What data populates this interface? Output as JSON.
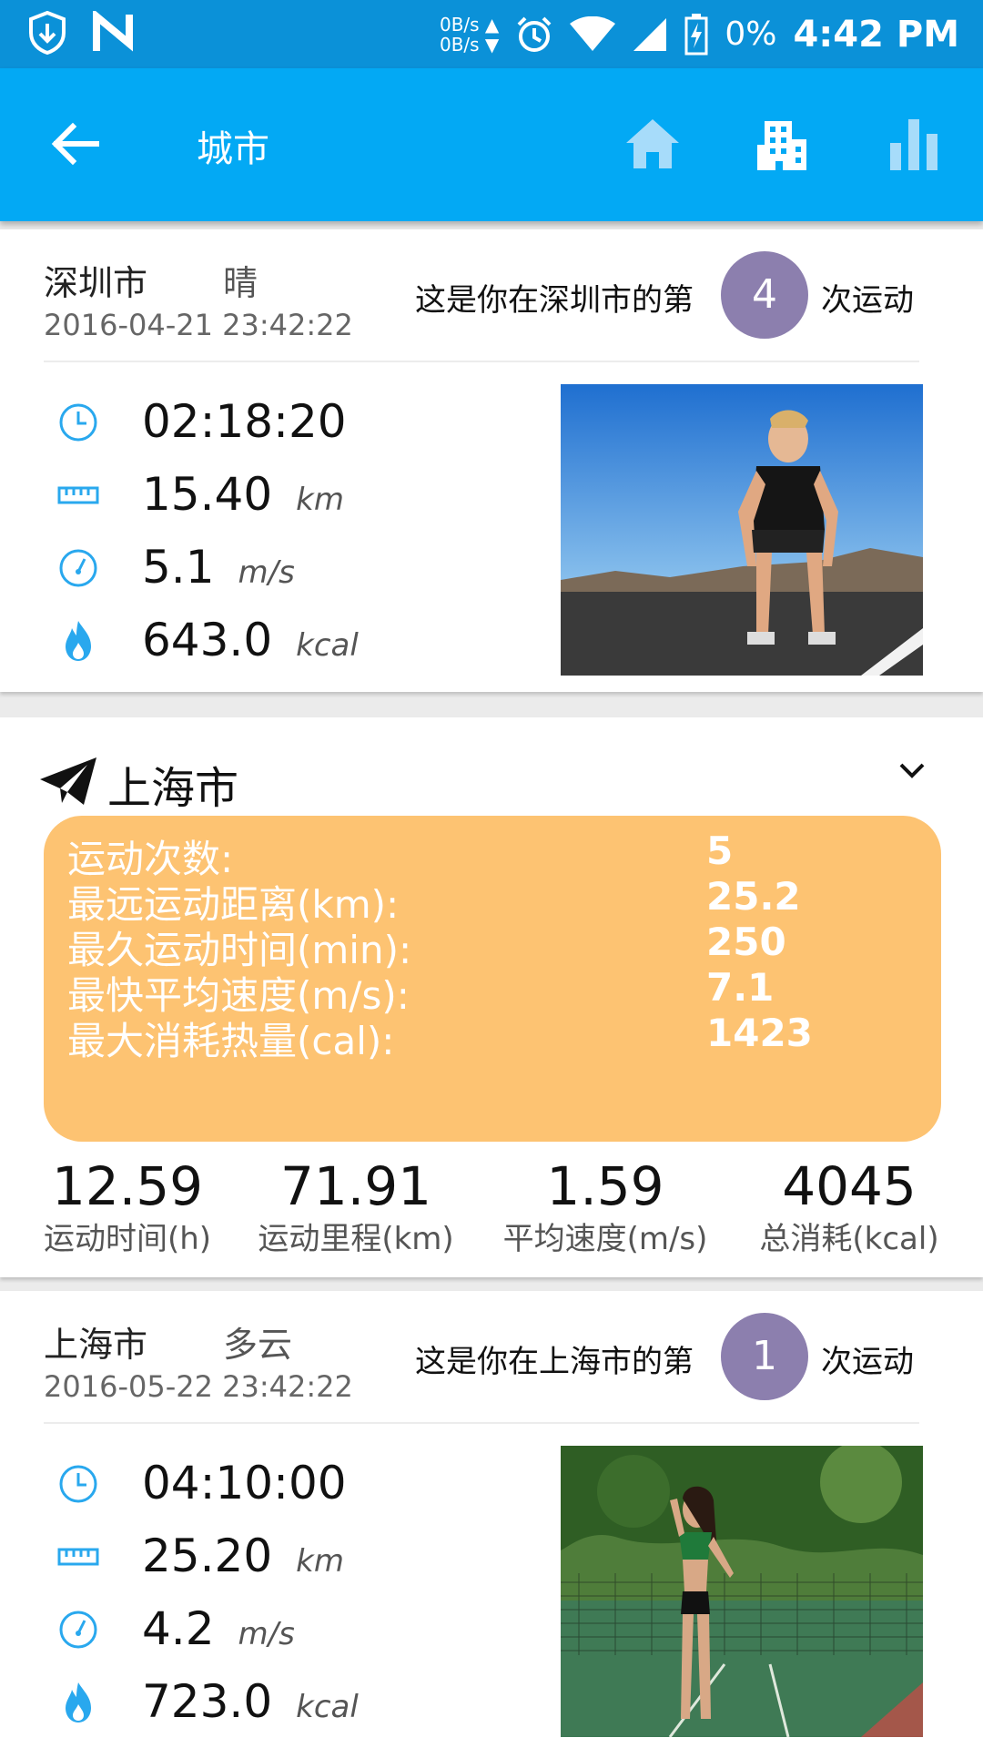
{
  "status": {
    "net_up": "0B/s",
    "net_down": "0B/s",
    "battery": "0%",
    "time": "4:42 PM"
  },
  "appbar": {
    "title": "城市"
  },
  "cards": [
    {
      "city": "深圳市",
      "weather": "晴",
      "date": "2016-04-21 23:42:22",
      "count_prefix": "这是你在深圳市的第",
      "count": "4",
      "count_suffix": "次运动",
      "duration": "02:18:20",
      "distance": "15.40",
      "distance_unit": "km",
      "speed": "5.1",
      "speed_unit": "m/s",
      "calories": "643.0",
      "calories_unit": "kcal"
    },
    {
      "city": "上海市",
      "weather": "多云",
      "date": "2016-05-22 23:42:22",
      "count_prefix": "这是你在上海市的第",
      "count": "1",
      "count_suffix": "次运动",
      "duration": "04:10:00",
      "distance": "25.20",
      "distance_unit": "km",
      "speed": "4.2",
      "speed_unit": "m/s",
      "calories": "723.0",
      "calories_unit": "kcal"
    }
  ],
  "summary": {
    "city": "上海市",
    "rows": [
      {
        "label": "运动次数:",
        "value": "5"
      },
      {
        "label": "最远运动距离(km):",
        "value": "25.2"
      },
      {
        "label": "最久运动时间(min):",
        "value": "250"
      },
      {
        "label": "最快平均速度(m/s):",
        "value": "7.1"
      },
      {
        "label": "最大消耗热量(cal):",
        "value": "1423"
      }
    ],
    "totals": [
      {
        "value": "12.59",
        "label": "运动时间(h)"
      },
      {
        "value": "71.91",
        "label": "运动里程(km)"
      },
      {
        "value": "1.59",
        "label": "平均速度(m/s)"
      },
      {
        "value": "4045",
        "label": "总消耗(kcal)"
      }
    ]
  },
  "colors": {
    "status_bar": "#0b91d8",
    "app_bar": "#03a9f4",
    "accent_icon": "#29a8ee",
    "badge": "#8c7fae",
    "summary_box": "#fdc372"
  }
}
